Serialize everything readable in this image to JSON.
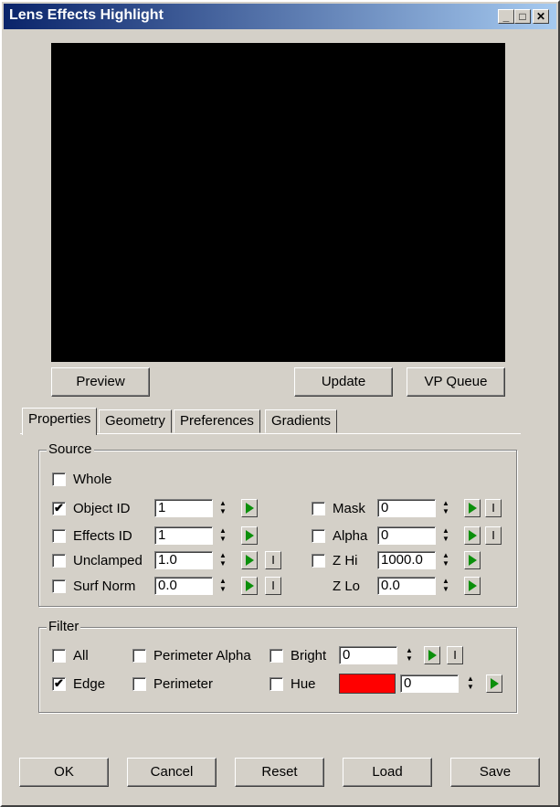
{
  "window": {
    "title": "Lens Effects Highlight",
    "minimize": "_",
    "maximize": "□",
    "close": "✕"
  },
  "preview_buttons": {
    "preview": "Preview",
    "update": "Update",
    "vp_queue": "VP Queue"
  },
  "tabs": [
    {
      "label": "Properties"
    },
    {
      "label": "Geometry"
    },
    {
      "label": "Preferences"
    },
    {
      "label": "Gradients"
    }
  ],
  "source": {
    "label": "Source",
    "whole": {
      "label": "Whole",
      "checked": false
    },
    "object_id": {
      "label": "Object ID",
      "checked": true,
      "value": "1"
    },
    "effects_id": {
      "label": "Effects ID",
      "checked": false,
      "value": "1"
    },
    "unclamped": {
      "label": "Unclamped",
      "checked": false,
      "value": "1.0"
    },
    "surf_norm": {
      "label": "Surf Norm",
      "checked": false,
      "value": "0.0"
    },
    "mask": {
      "label": "Mask",
      "checked": false,
      "value": "0"
    },
    "alpha": {
      "label": "Alpha",
      "checked": false,
      "value": "0"
    },
    "z_hi": {
      "label": "Z Hi",
      "checked": false,
      "value": "1000.0"
    },
    "z_lo": {
      "label": "Z Lo",
      "value": "0.0"
    },
    "invert_label": "I"
  },
  "filter": {
    "label": "Filter",
    "all": {
      "label": "All",
      "checked": false
    },
    "edge": {
      "label": "Edge",
      "checked": true
    },
    "perimeter_alpha": {
      "label": "Perimeter Alpha",
      "checked": false
    },
    "perimeter": {
      "label": "Perimeter",
      "checked": false
    },
    "bright": {
      "label": "Bright",
      "checked": false,
      "value": "0"
    },
    "hue": {
      "label": "Hue",
      "checked": false,
      "value": "0",
      "color": "#ff0000"
    }
  },
  "checkmark": "✔",
  "bottom_buttons": {
    "ok": "OK",
    "cancel": "Cancel",
    "reset": "Reset",
    "load": "Load",
    "save": "Save"
  }
}
